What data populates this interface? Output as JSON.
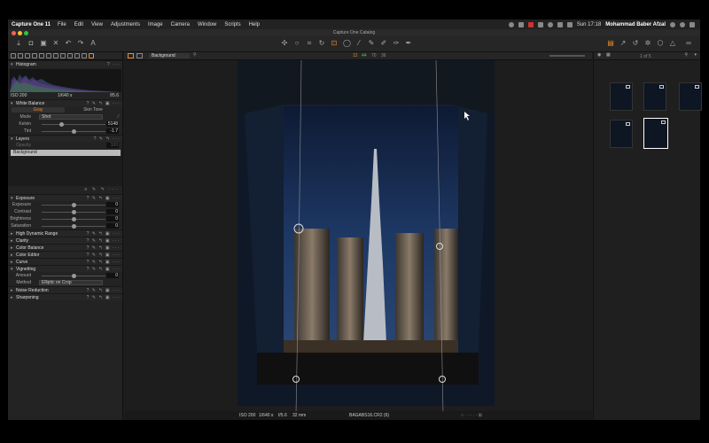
{
  "menubar": {
    "app_name": "Capture One 11",
    "items": [
      "File",
      "Edit",
      "View",
      "Adjustments",
      "Image",
      "Camera",
      "Window",
      "Scripts",
      "Help"
    ],
    "clock": "Sun 17:18",
    "user": "Mohammad Baber Afzal"
  },
  "window": {
    "title": "Capture One Catalog"
  },
  "left_panel": {
    "histogram": {
      "label": "Histogram",
      "iso": "ISO 200",
      "shutter": "1/640 s",
      "aperture": "f/5.6"
    },
    "white_balance": {
      "label": "White Balance",
      "tabs": [
        "Gray",
        "Skin Tone"
      ],
      "mode_label": "Mode",
      "mode_value": "Shot",
      "kelvin_label": "Kelvin",
      "kelvin_value": "5148",
      "tint_label": "Tint",
      "tint_value": "-1.7"
    },
    "layers": {
      "label": "Layers",
      "opacity_label": "Opacity",
      "opacity_value": "100",
      "layer_name": "Background"
    },
    "exposure": {
      "label": "Exposure",
      "rows": [
        {
          "label": "Exposure",
          "value": "0"
        },
        {
          "label": "Contrast",
          "value": "0"
        },
        {
          "label": "Brightness",
          "value": "0"
        },
        {
          "label": "Saturation",
          "value": "0"
        }
      ]
    },
    "collapsed_tools": [
      "High Dynamic Range",
      "Clarity",
      "Color Balance",
      "Color Editor",
      "Curve"
    ],
    "vignetting": {
      "label": "Vignetting",
      "amount_label": "Amount",
      "amount_value": "0",
      "method_label": "Method",
      "method_value": "Elliptic on Crop"
    },
    "tail_tools": [
      "Noise Reduction",
      "Sharpening"
    ]
  },
  "viewer": {
    "layer_select": "Background",
    "zoom_presets": [
      "12",
      "44",
      "70",
      "36"
    ],
    "info": {
      "iso": "ISO 200",
      "shutter": "1/640 s",
      "aperture": "f/5.6",
      "focal": "32 mm",
      "filename": "BAGABS16.CR2 (6)"
    }
  },
  "browser": {
    "count": "1 of 5"
  },
  "colors": {
    "accent": "#e98a2a",
    "panel": "#232323",
    "background": "#000000"
  },
  "icons": [
    "download-icon",
    "camera-icon",
    "trash-icon",
    "undo-icon",
    "redo-icon",
    "text-icon",
    "crop-icon",
    "rotate-icon",
    "keystone-icon",
    "picker-icon",
    "brush-icon",
    "eraser-icon",
    "gradient-icon",
    "grid-icon",
    "search-icon",
    "glasses-icon",
    "warning-icon"
  ]
}
